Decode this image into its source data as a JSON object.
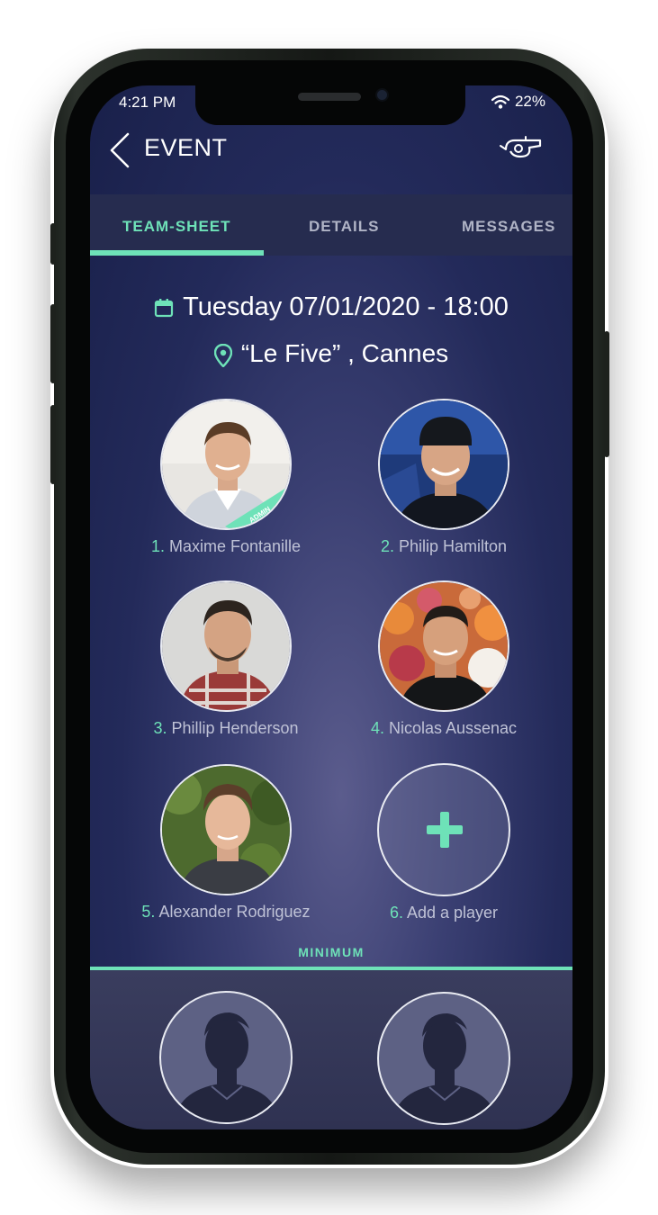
{
  "status_bar": {
    "time": "4:21 PM",
    "battery": "22%"
  },
  "header": {
    "title": "EVENT"
  },
  "tabs": [
    {
      "label": "TEAM-SHEET",
      "active": true
    },
    {
      "label": "DETAILS",
      "active": false
    },
    {
      "label": "MESSAGES",
      "active": false
    }
  ],
  "event": {
    "datetime": "Tuesday 07/01/2020 - 18:00",
    "location": "“Le Five” , Cannes"
  },
  "players": [
    {
      "number": "1.",
      "name": "Maxime Fontanille",
      "badge": "ADMIN"
    },
    {
      "number": "2.",
      "name": "Philip Hamilton"
    },
    {
      "number": "3.",
      "name": "Phillip Henderson"
    },
    {
      "number": "4.",
      "name": "Nicolas Aussenac"
    },
    {
      "number": "5. ",
      "name": "Alexander Rodriguez"
    }
  ],
  "add_player": {
    "number": "6. ",
    "label": "Add a player"
  },
  "minimum_label": "MINIMUM",
  "colors": {
    "accent": "#6ee2b8",
    "background": "#232a5a",
    "tabbar": "#262c4f"
  },
  "icons": {
    "back": "chevron-left-icon",
    "whistle": "whistle-icon",
    "calendar": "calendar-icon",
    "location": "location-pin-icon",
    "wifi": "wifi-icon"
  }
}
